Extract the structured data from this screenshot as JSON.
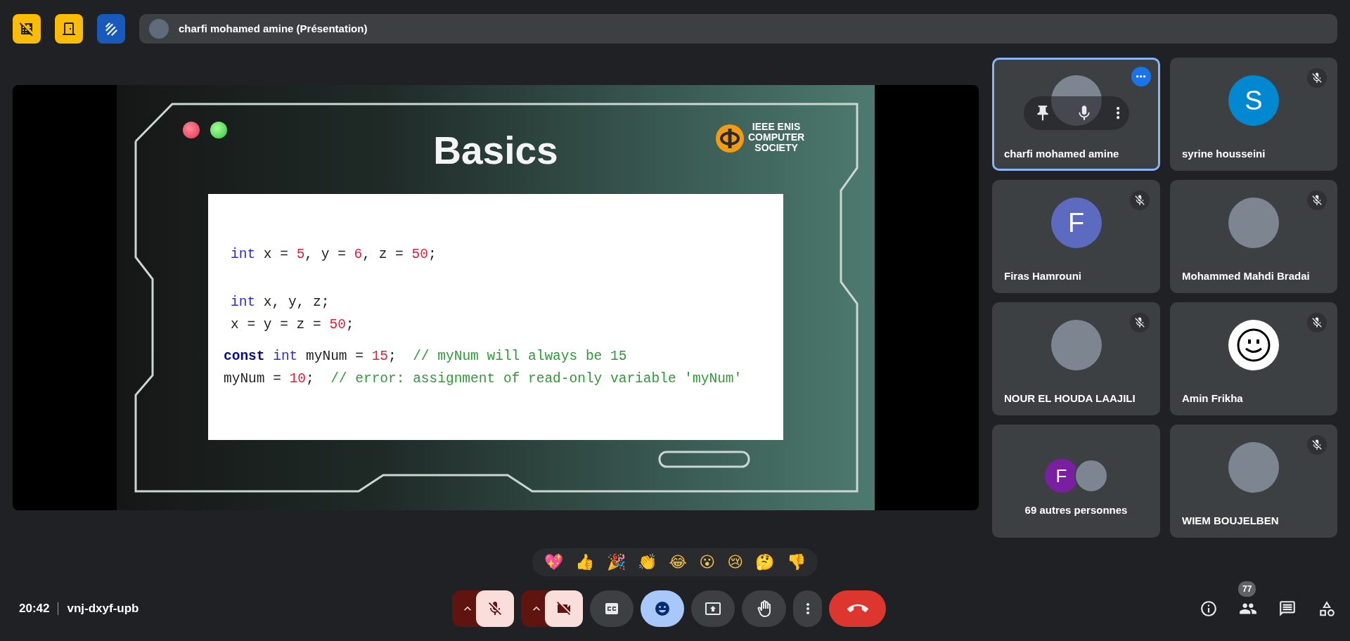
{
  "top_buttons": [
    {
      "kind": "hide-tiles",
      "color": "#fbbc04"
    },
    {
      "kind": "door",
      "color": "#fbbc04"
    },
    {
      "kind": "whiteboard",
      "color": "#185abc"
    }
  ],
  "presenter_chip": {
    "label": "charfi mohamed amine (Présentation)"
  },
  "slide": {
    "title": "Basics",
    "logo_lines": [
      "IEEE ENIS",
      "COMPUTER",
      "SOCIETY"
    ],
    "code_lines": [
      [
        {
          "kind": "type",
          "text": "int"
        },
        {
          "kind": "plain",
          "text": " x = "
        },
        {
          "kind": "number",
          "text": "5"
        },
        {
          "kind": "plain",
          "text": ", y = "
        },
        {
          "kind": "number",
          "text": "6"
        },
        {
          "kind": "plain",
          "text": ", z = "
        },
        {
          "kind": "number",
          "text": "50"
        },
        {
          "kind": "plain",
          "text": ";"
        }
      ],
      [
        {
          "kind": "type",
          "text": "int"
        },
        {
          "kind": "plain",
          "text": " x, y, z;"
        }
      ],
      [
        {
          "kind": "plain",
          "text": "x = y = z = "
        },
        {
          "kind": "number",
          "text": "50"
        },
        {
          "kind": "plain",
          "text": ";"
        }
      ],
      [
        {
          "kind": "storage",
          "text": "const"
        },
        {
          "kind": "type",
          "text": " int"
        },
        {
          "kind": "plain",
          "text": " myNum = "
        },
        {
          "kind": "number",
          "text": "15"
        },
        {
          "kind": "plain",
          "text": ";  "
        },
        {
          "kind": "comment",
          "text": "// myNum will always be 15"
        }
      ],
      [
        {
          "kind": "plain",
          "text": "myNum = "
        },
        {
          "kind": "number",
          "text": "10"
        },
        {
          "kind": "plain",
          "text": ";  "
        },
        {
          "kind": "comment",
          "text": "// error: assignment of read-only variable 'myNum'"
        }
      ]
    ]
  },
  "participants": [
    {
      "kind": "person",
      "name": "charfi mohamed amine",
      "avatar": {
        "kind": "photo"
      },
      "selected": true,
      "muted": false,
      "hovered": true
    },
    {
      "kind": "person",
      "name": "syrine housseini",
      "avatar": {
        "kind": "letter",
        "letter": "S",
        "color": "#0288d1"
      },
      "selected": false,
      "muted": true,
      "hovered": false
    },
    {
      "kind": "person",
      "name": "Firas Hamrouni",
      "avatar": {
        "kind": "letter",
        "letter": "F",
        "color": "#5c6bc0"
      },
      "selected": false,
      "muted": true,
      "hovered": false
    },
    {
      "kind": "person",
      "name": "Mohammed Mahdi Bradai",
      "avatar": {
        "kind": "photo"
      },
      "selected": false,
      "muted": true,
      "hovered": false
    },
    {
      "kind": "person",
      "name": "NOUR EL HOUDA LAAJILI",
      "avatar": {
        "kind": "photo"
      },
      "selected": false,
      "muted": true,
      "hovered": false
    },
    {
      "kind": "person",
      "name": "Amin Frikha",
      "avatar": {
        "kind": "smiley"
      },
      "selected": false,
      "muted": true,
      "hovered": false
    },
    {
      "kind": "others",
      "label": "69 autres personnes",
      "avatars": [
        {
          "kind": "letter",
          "letter": "F",
          "color": "#7b1fa2"
        },
        {
          "kind": "photo"
        }
      ]
    },
    {
      "kind": "person",
      "name": "WIEM BOUJELBEN",
      "avatar": {
        "kind": "photo"
      },
      "selected": false,
      "muted": true,
      "hovered": false
    }
  ],
  "reactions": [
    "💖",
    "👍",
    "🎉",
    "👏",
    "😂",
    "😮",
    "😢",
    "🤔",
    "👎"
  ],
  "footer": {
    "time": "20:42",
    "meeting_code": "vnj-dxyf-upb"
  },
  "controls": [
    {
      "kind": "mic",
      "on": false
    },
    {
      "kind": "camera",
      "on": false
    },
    {
      "kind": "captions",
      "on": false
    },
    {
      "kind": "reactions",
      "on": true
    },
    {
      "kind": "present"
    },
    {
      "kind": "hand",
      "on": false
    },
    {
      "kind": "more"
    },
    {
      "kind": "end"
    }
  ],
  "side_buttons": [
    {
      "kind": "info"
    },
    {
      "kind": "people",
      "badge": "77"
    },
    {
      "kind": "chat"
    },
    {
      "kind": "activities"
    }
  ]
}
